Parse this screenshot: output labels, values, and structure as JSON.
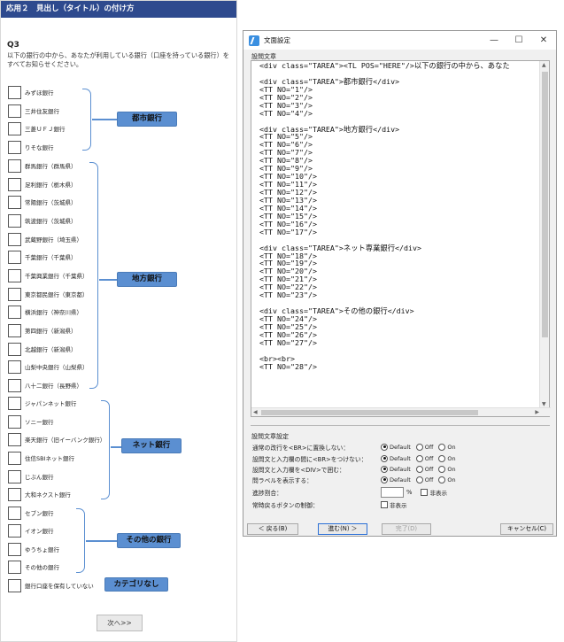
{
  "survey": {
    "header": "応用２　見出し（タイトル）の付け方",
    "question_no": "Q3",
    "question_text": "以下の銀行の中から、あなたが利用している銀行（口座を持っている銀行）をすべてお知らせください。",
    "options": [
      "みずほ銀行",
      "三井住友銀行",
      "三菱ＵＦＪ銀行",
      "りそな銀行",
      "群馬銀行（群馬県）",
      "足利銀行（栃木県）",
      "常陽銀行（茨城県）",
      "筑波銀行（茨城県）",
      "武蔵野銀行（埼玉県）",
      "千葉銀行（千葉県）",
      "千葉興業銀行（千葉県）",
      "東京都民銀行（東京都）",
      "横浜銀行（神奈川県）",
      "第四銀行（新潟県）",
      "北越銀行（新潟県）",
      "山梨中央銀行（山梨県）",
      "八十二銀行（長野県）",
      "ジャパンネット銀行",
      "ソニー銀行",
      "楽天銀行（旧イーバンク銀行）",
      "住信SBIネット銀行",
      "じぶん銀行",
      "大和ネクスト銀行",
      "セブン銀行",
      "イオン銀行",
      "ゆうちょ銀行",
      "その他の銀行",
      "銀行口座を保有していない"
    ],
    "categories": {
      "city": "都市銀行",
      "regional": "地方銀行",
      "net": "ネット銀行",
      "other": "その他の銀行",
      "none": "カテゴリなし"
    },
    "next_button": "次へ>>",
    "accent_color": "#5b8fd1",
    "header_color": "#2e4a8e"
  },
  "dialog": {
    "title": "文面設定",
    "minimize": "—",
    "maximize": "☐",
    "close": "✕",
    "section_label": "設問文章",
    "code_lines": [
      "<div class=\"TAREA\"><TL POS=\"HERE\"/>以下の銀行の中から、あなた",
      "",
      "<div class=\"TAREA\">都市銀行</div>",
      "<TT NO=\"1\"/>",
      "<TT NO=\"2\"/>",
      "<TT NO=\"3\"/>",
      "<TT NO=\"4\"/>",
      "",
      "<div class=\"TAREA\">地方銀行</div>",
      "<TT NO=\"5\"/>",
      "<TT NO=\"6\"/>",
      "<TT NO=\"7\"/>",
      "<TT NO=\"8\"/>",
      "<TT NO=\"9\"/>",
      "<TT NO=\"10\"/>",
      "<TT NO=\"11\"/>",
      "<TT NO=\"12\"/>",
      "<TT NO=\"13\"/>",
      "<TT NO=\"14\"/>",
      "<TT NO=\"15\"/>",
      "<TT NO=\"16\"/>",
      "<TT NO=\"17\"/>",
      "",
      "<div class=\"TAREA\">ネット専業銀行</div>",
      "<TT NO=\"18\"/>",
      "<TT NO=\"19\"/>",
      "<TT NO=\"20\"/>",
      "<TT NO=\"21\"/>",
      "<TT NO=\"22\"/>",
      "<TT NO=\"23\"/>",
      "",
      "<div class=\"TAREA\">その他の銀行</div>",
      "<TT NO=\"24\"/>",
      "<TT NO=\"25\"/>",
      "<TT NO=\"26\"/>",
      "<TT NO=\"27\"/>",
      "",
      "<br><br>",
      "<TT NO=\"28\"/>"
    ],
    "settings": {
      "title": "設問文章設定",
      "row1_label": "通常の改行を<BR>に置換しない：",
      "row2_label": "設問文と入力欄の間に<BR>をつけない：",
      "row3_label": "設問文と入力欄を<DIV>で囲む：",
      "row4_label": "問ラベルを表示する：",
      "row5_label": "進捗割合：",
      "row6_label": "常時戻るボタンの制御：",
      "opt_default": "Default",
      "opt_off": "Off",
      "opt_on": "On",
      "percent": "%",
      "hide": "非表示"
    },
    "buttons": {
      "back": "＜ 戻る(B)",
      "next": "進む(N) ＞",
      "done": "完了(D)",
      "cancel": "キャンセル(C)"
    }
  }
}
